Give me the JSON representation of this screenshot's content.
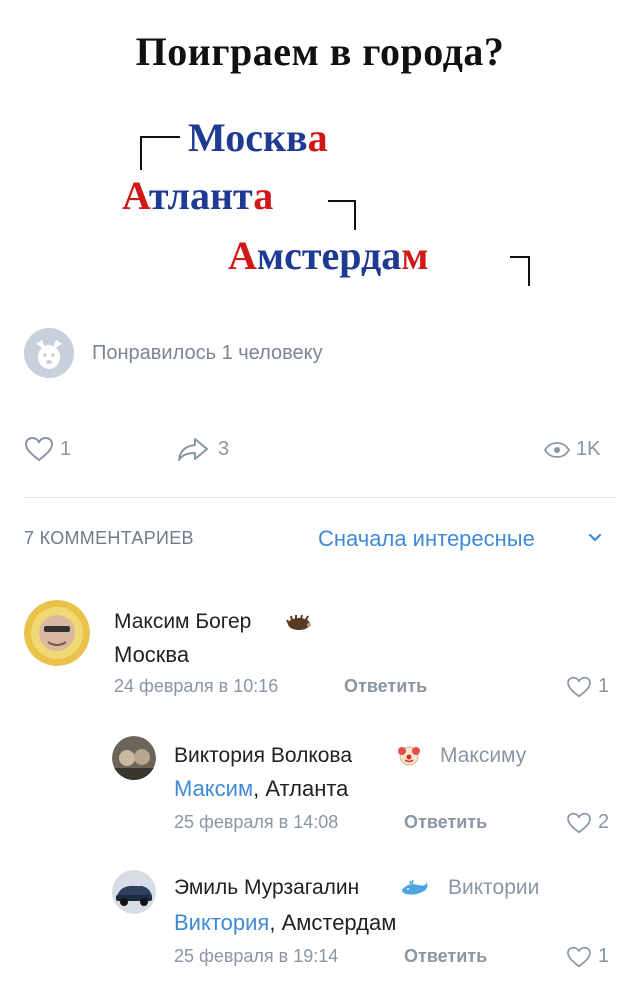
{
  "post": {
    "title": "Поиграем в города?",
    "cities": [
      {
        "blue": "Москв",
        "red": "а"
      },
      {
        "blue": "",
        "red": "А",
        "rest_blue": "тлант",
        "rest_red": "а"
      },
      {
        "blue": "",
        "red": "А",
        "rest_blue": "мстерда",
        "rest_red": "м"
      }
    ]
  },
  "liked": {
    "text": "Понравилось 1 человеку"
  },
  "stats": {
    "likes": "1",
    "shares": "3",
    "views": "1K"
  },
  "comments_header": {
    "count": "7 КОММЕНТАРИЕВ",
    "sort": "Сначала интересные"
  },
  "comments": [
    {
      "author": "Максим Богер",
      "text": "Москва",
      "date": "24 февраля в 10:16",
      "reply": "Ответить",
      "likes": "1"
    },
    {
      "author": "Виктория Волкова",
      "to": "Максиму",
      "mention": "Максим",
      "text": ", Атланта",
      "date": "25 февраля в 14:08",
      "reply": "Ответить",
      "likes": "2"
    },
    {
      "author": "Эмиль Мурзагалин",
      "to": "Виктории",
      "mention": "Виктория",
      "text": ", Амстердам",
      "date": "25 февраля в 19:14",
      "reply": "Ответить",
      "likes": "1"
    }
  ],
  "colors": {
    "accent": "#3f8ad8",
    "city_blue": "#1f3a93",
    "city_red": "#d01818",
    "meta": "#8a96a3"
  },
  "icons": [
    "dog-avatar-icon",
    "heart-icon",
    "share-icon",
    "eye-icon",
    "chevron-down-icon",
    "hedgehog-emoji-icon",
    "clown-emoji-icon",
    "whale-emoji-icon"
  ]
}
